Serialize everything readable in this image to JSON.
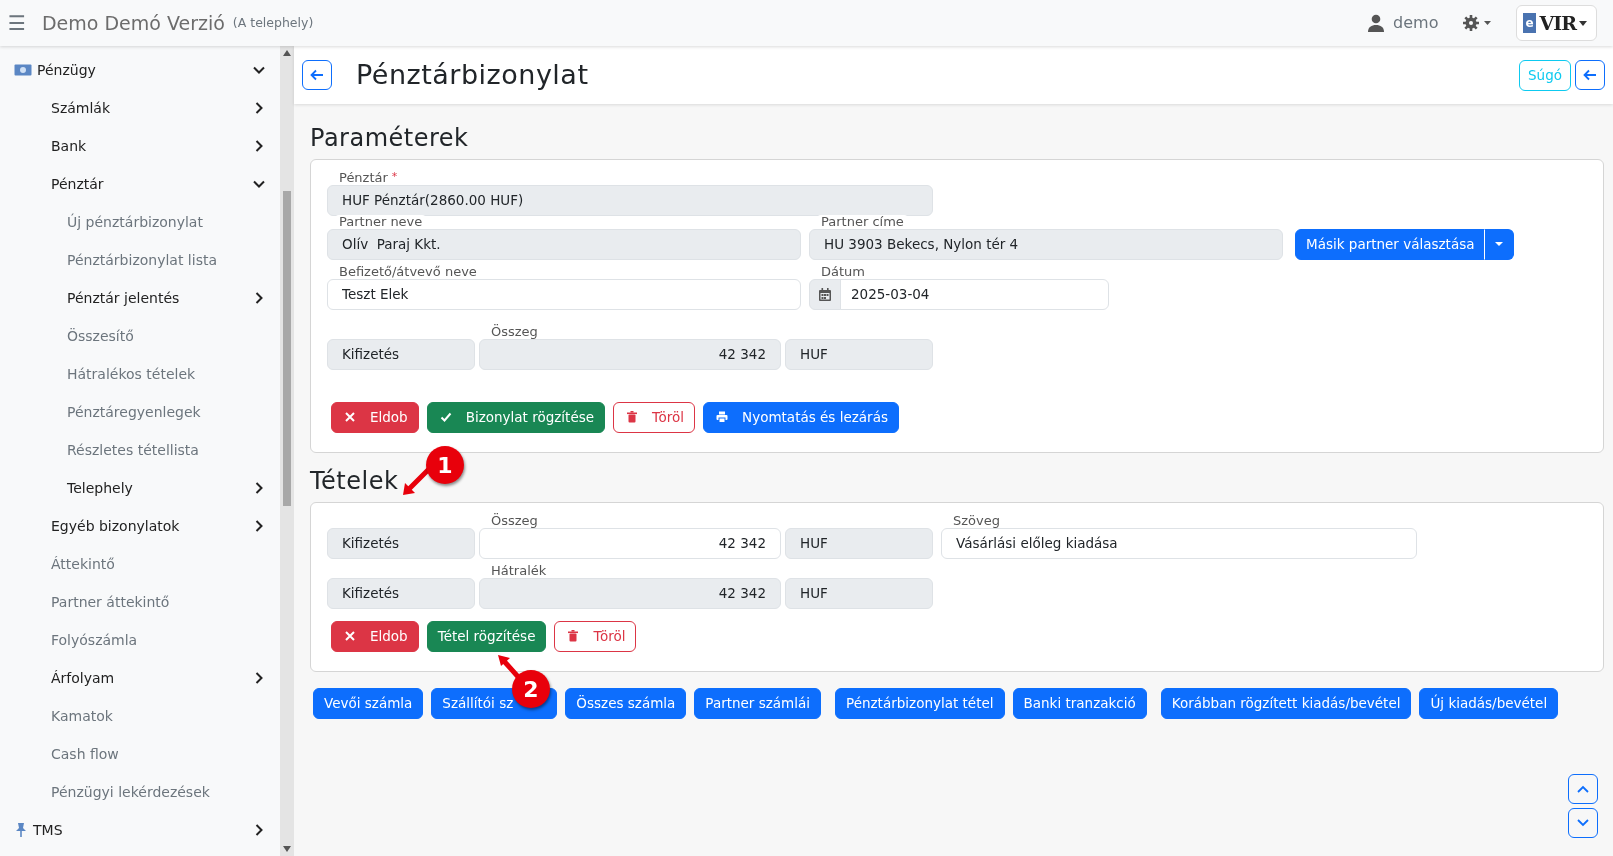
{
  "topbar": {
    "menu": "☰",
    "title": "Demo Demó Verzió",
    "subtitle": "(A telephely)",
    "user": "demo",
    "logo": {
      "prefix": "e",
      "name": "VIR"
    }
  },
  "sidebar": {
    "items": [
      {
        "label": "Pénzügy",
        "expanded": true,
        "children": [
          {
            "label": "Számlák",
            "expanded": false
          },
          {
            "label": "Bank",
            "expanded": false
          },
          {
            "label": "Pénztár",
            "expanded": true,
            "children": [
              {
                "label": "Új pénztárbizonylat"
              },
              {
                "label": "Pénztárbizonylat lista"
              },
              {
                "label": "Pénztár jelentés",
                "expanded": false
              },
              {
                "label": "Összesítő"
              },
              {
                "label": "Hátralékos tételek"
              },
              {
                "label": "Pénztáregyenlegek"
              },
              {
                "label": "Részletes tétellista"
              },
              {
                "label": "Telephely",
                "expanded": false
              }
            ]
          },
          {
            "label": "Egyéb bizonylatok",
            "expanded": false
          },
          {
            "label": "Áttekintő"
          },
          {
            "label": "Partner áttekintő"
          },
          {
            "label": "Folyószámla"
          },
          {
            "label": "Árfolyam",
            "expanded": false
          },
          {
            "label": "Kamatok"
          },
          {
            "label": "Cash flow"
          },
          {
            "label": "Pénzügyi lekérdezések"
          }
        ]
      },
      {
        "label": "TMS",
        "expanded": false
      }
    ]
  },
  "header": {
    "title": "Pénztárbizonylat",
    "help": "Súgó"
  },
  "parameters": {
    "title": "Paraméterek",
    "rows": [
      [
        {
          "kind": "text",
          "label": "Pénztár",
          "required": "*",
          "value": "HUF Pénztár(2860.00 HUF)",
          "readonly": true
        }
      ],
      [
        {
          "kind": "text",
          "label": "Partner neve",
          "value": "Olív  Paraj Kkt.",
          "readonly": true
        },
        {
          "kind": "text",
          "label": "Partner címe",
          "value": "HU 3903 Bekecs, Nylon tér 4",
          "readonly": true
        },
        {
          "kind": "split-button",
          "label": "Másik partner választása"
        }
      ],
      [
        {
          "kind": "text",
          "label": "Befizető/átvevő neve",
          "value": "Teszt Elek",
          "readonly": false
        },
        {
          "kind": "date",
          "label": "Dátum",
          "value": "2025-03-04",
          "readonly": false
        }
      ],
      [
        {
          "kind": "text",
          "value": "Kifizetés",
          "readonly": true
        },
        {
          "kind": "amount",
          "label": "Összeg",
          "value": "42 342",
          "readonly": true
        },
        {
          "kind": "text",
          "value": "HUF",
          "readonly": true
        }
      ]
    ],
    "buttons": [
      {
        "kind": "discard",
        "label": "Eldob"
      },
      {
        "kind": "save",
        "label": "Bizonylat rögzítése"
      },
      {
        "kind": "delete",
        "label": "Töröl"
      },
      {
        "kind": "print",
        "label": "Nyomtatás és lezárás"
      }
    ]
  },
  "items": {
    "title": "Tételek",
    "rows": [
      [
        {
          "kind": "text",
          "value": "Kifizetés",
          "readonly": true
        },
        {
          "kind": "amount",
          "label": "Összeg",
          "value": "42 342",
          "readonly": false
        },
        {
          "kind": "text",
          "value": "HUF",
          "readonly": true
        },
        {
          "kind": "text",
          "label": "Szöveg",
          "value": "Vásárlási előleg kiadása",
          "readonly": false
        }
      ],
      [
        {
          "kind": "text",
          "value": "Kifizetés",
          "readonly": true
        },
        {
          "kind": "amount",
          "label": "Hátralék",
          "value": "42 342",
          "readonly": true
        },
        {
          "kind": "text",
          "value": "HUF",
          "readonly": true
        }
      ]
    ],
    "buttons": [
      {
        "kind": "discard",
        "label": "Eldob"
      },
      {
        "kind": "plain-save",
        "label": "Tétel rögzítése"
      },
      {
        "kind": "delete",
        "label": "Töröl"
      }
    ]
  },
  "links": [
    "Vevői számla",
    "Szállítói sz",
    "Összes számla",
    "Partner számlái",
    "Pénztárbizonylat tétel",
    "Banki tranzakció",
    "Korábban rögzített kiadás/bevétel",
    "Új kiadás/bevétel"
  ],
  "callouts": [
    "1",
    "2"
  ]
}
